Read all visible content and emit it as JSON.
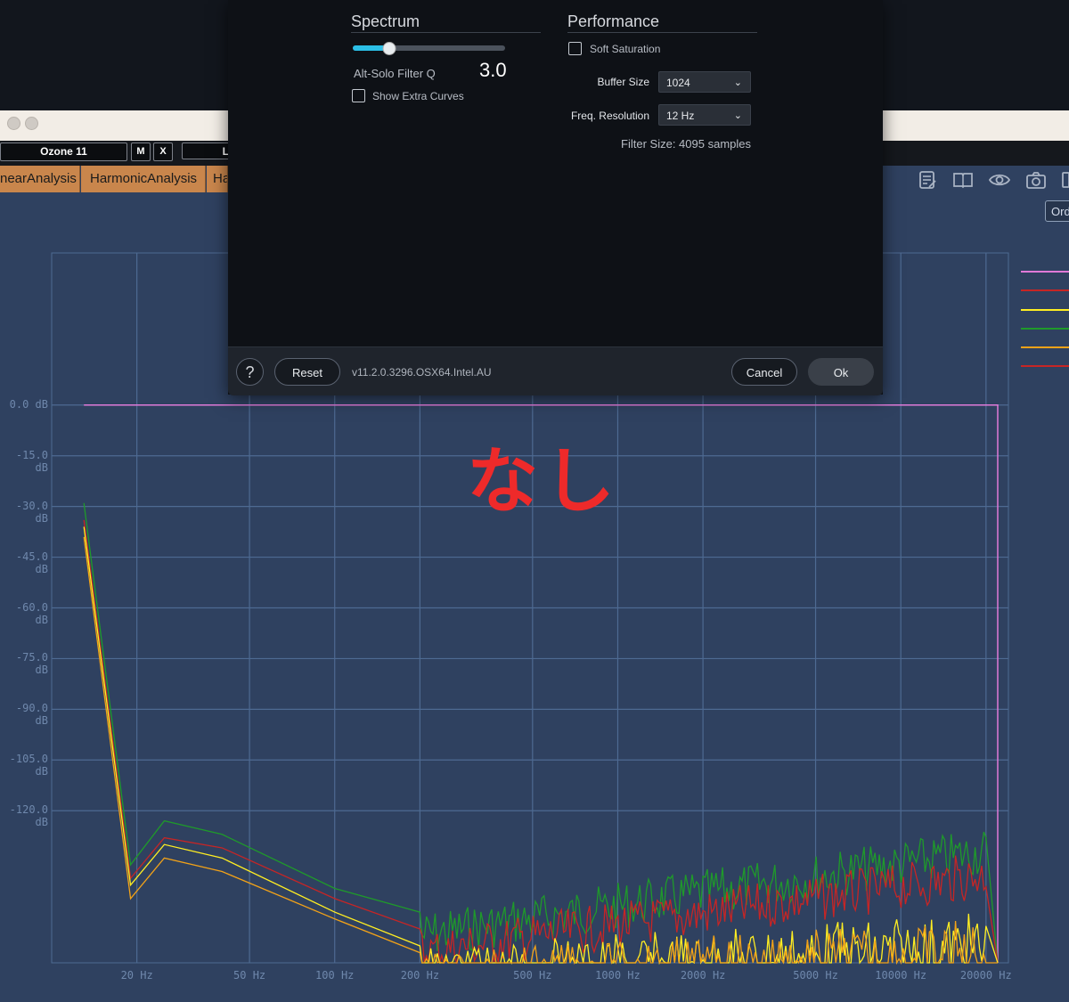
{
  "host": {
    "preset_name": "Ozone 11",
    "m_label": "M",
    "x_label": "X",
    "box_l": "L",
    "tabs": [
      {
        "label": "nearAnalysis"
      },
      {
        "label": "HarmonicAnalysis"
      },
      {
        "label": "Ha"
      }
    ],
    "order_label": "Ord",
    "icons": [
      "notes-icon",
      "book-icon",
      "eye-icon",
      "camera-icon"
    ]
  },
  "dialog": {
    "spectrum": {
      "title": "Spectrum",
      "filter_q_label": "Alt-Solo Filter Q",
      "filter_q_value": "3.0",
      "slider_fraction": 0.24,
      "show_extra_curves_label": "Show Extra Curves",
      "show_extra_curves_checked": false
    },
    "performance": {
      "title": "Performance",
      "soft_saturation_label": "Soft Saturation",
      "soft_saturation_checked": false,
      "buffer_size_label": "Buffer Size",
      "buffer_size_value": "1024",
      "freq_resolution_label": "Freq. Resolution",
      "freq_resolution_value": "12 Hz",
      "filter_size_text": "Filter Size: 4095 samples"
    },
    "footer": {
      "help_label": "?",
      "reset_label": "Reset",
      "version": "v11.2.0.3296.OSX64.Intel.AU",
      "cancel_label": "Cancel",
      "ok_label": "Ok"
    }
  },
  "annotation": "なし",
  "colors": {
    "accent": "#2bbfe6",
    "plot_bg": "#2f4160",
    "grid": "#4e6a92",
    "annotation_red": "#ee2a2a"
  },
  "chart_data": {
    "type": "line",
    "xscale": "log",
    "x_tick_labels": [
      "20 Hz",
      "50 Hz",
      "100 Hz",
      "200 Hz",
      "500 Hz",
      "1000 Hz",
      "2000 Hz",
      "5000 Hz",
      "10000 Hz",
      "20000 Hz"
    ],
    "x_ticks": [
      20,
      50,
      100,
      200,
      500,
      1000,
      2000,
      5000,
      10000,
      20000
    ],
    "y_tick_labels": [
      "0.0 dB",
      "-15.0 dB",
      "-30.0 dB",
      "-45.0 dB",
      "-60.0 dB",
      "-75.0 dB",
      "-90.0 dB",
      "-105.0 dB",
      "-120.0 dB"
    ],
    "y_ticks": [
      0,
      -15,
      -30,
      -45,
      -60,
      -75,
      -90,
      -105,
      -120
    ],
    "ylim": [
      -165,
      45
    ],
    "xlim": [
      10,
      24000
    ],
    "series": [
      {
        "color": "#e07ad8",
        "x": [
          13,
          22000
        ],
        "y": [
          0,
          0
        ]
      },
      {
        "color": "#1f9a2a",
        "x": [
          13,
          19,
          25,
          40,
          100,
          200,
          20000
        ],
        "y": [
          -29,
          -136,
          -123,
          -127,
          -143,
          -150,
          -125
        ]
      },
      {
        "color": "#c72525",
        "x": [
          13,
          19,
          25,
          40,
          100,
          200,
          20000
        ],
        "y": [
          -34,
          -140,
          -128,
          -131,
          -146,
          -155,
          -132
        ]
      },
      {
        "color": "#ffee22",
        "x": [
          13,
          19,
          25,
          40,
          100,
          200,
          20000
        ],
        "y": [
          -36,
          -142,
          -130,
          -134,
          -150,
          -160,
          -150
        ]
      },
      {
        "color": "#f2a218",
        "x": [
          13,
          19,
          25,
          40,
          100,
          200,
          20000
        ],
        "y": [
          -39,
          -146,
          -134,
          -138,
          -152,
          -162,
          -152
        ]
      }
    ]
  }
}
